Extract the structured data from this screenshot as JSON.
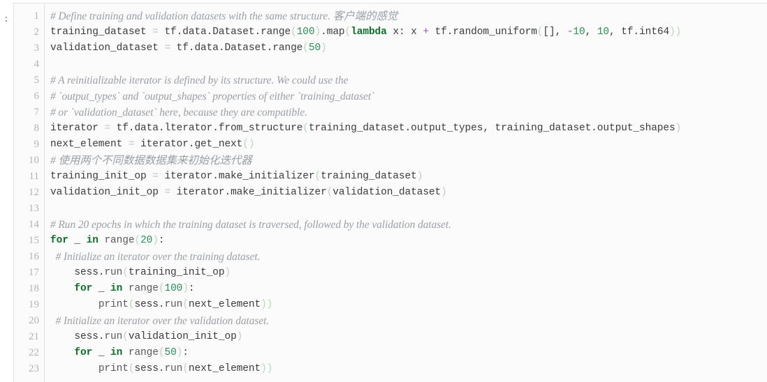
{
  "prompt": {
    "mark": ":"
  },
  "editor": {
    "language": "python",
    "first_line_number": 1,
    "total_lines_visible": 23,
    "background_color": "#fbfbfb",
    "gutter_color": "#fbfbfb",
    "line_number_color": "#b4b4b4",
    "text_color": "#3c3c3c",
    "comment_color": "#9aa0a6",
    "keyword_color": "#136c2e",
    "number_color": "#2e8b57",
    "operator_color": "#9b4dca"
  },
  "line_numbers": [
    "1",
    "2",
    "3",
    "4",
    "5",
    "6",
    "7",
    "8",
    "9",
    "10",
    "11",
    "12",
    "13",
    "14",
    "15",
    "16",
    "17",
    "18",
    "19",
    "20",
    "21",
    "22",
    "23"
  ],
  "lines": [
    {
      "number": "1",
      "text": "# Define training and validation datasets with the same structure. 客户端的感觉",
      "tokens": [
        {
          "t": "comment",
          "v": "# Define training and validation datasets with the same structure. "
        },
        {
          "t": "comment-cjk",
          "v": "客户端的感觉"
        }
      ]
    },
    {
      "number": "2",
      "text": "training_dataset = tf.data.Dataset.range(100).map(lambda x: x + tf.random_uniform([], -10, 10, tf.int64))",
      "tokens": [
        {
          "t": "text",
          "v": "training_dataset "
        },
        {
          "t": "assign",
          "v": "="
        },
        {
          "t": "text",
          "v": " tf."
        },
        {
          "t": "text",
          "v": "data."
        },
        {
          "t": "text",
          "v": "Dataset."
        },
        {
          "t": "text",
          "v": "range"
        },
        {
          "t": "paren",
          "v": "("
        },
        {
          "t": "number",
          "v": "100"
        },
        {
          "t": "paren",
          "v": ")"
        },
        {
          "t": "text",
          "v": ".map"
        },
        {
          "t": "paren",
          "v": "("
        },
        {
          "t": "keyword",
          "v": "lambda"
        },
        {
          "t": "text",
          "v": " x: x "
        },
        {
          "t": "operator",
          "v": "+"
        },
        {
          "t": "text",
          "v": " tf."
        },
        {
          "t": "text",
          "v": "random_uniform"
        },
        {
          "t": "paren",
          "v": "("
        },
        {
          "t": "text",
          "v": "[], "
        },
        {
          "t": "operator",
          "v": "-"
        },
        {
          "t": "number",
          "v": "10"
        },
        {
          "t": "text",
          "v": ", "
        },
        {
          "t": "number",
          "v": "10"
        },
        {
          "t": "text",
          "v": ", tf."
        },
        {
          "t": "text",
          "v": "int64"
        },
        {
          "t": "paren",
          "v": "))"
        }
      ]
    },
    {
      "number": "3",
      "text": "validation_dataset = tf.data.Dataset.range(50)",
      "tokens": [
        {
          "t": "text",
          "v": "validation_dataset "
        },
        {
          "t": "assign",
          "v": "="
        },
        {
          "t": "text",
          "v": " tf."
        },
        {
          "t": "text",
          "v": "data."
        },
        {
          "t": "text",
          "v": "Dataset."
        },
        {
          "t": "text",
          "v": "range"
        },
        {
          "t": "paren",
          "v": "("
        },
        {
          "t": "number",
          "v": "50"
        },
        {
          "t": "paren",
          "v": ")"
        }
      ]
    },
    {
      "number": "4",
      "text": "",
      "tokens": []
    },
    {
      "number": "5",
      "text": "# A reinitializable iterator is defined by its structure. We could use the",
      "tokens": [
        {
          "t": "comment",
          "v": "# A reinitializable iterator is defined by its structure. We could use the"
        }
      ]
    },
    {
      "number": "6",
      "text": "# `output_types` and `output_shapes` properties of either `training_dataset`",
      "tokens": [
        {
          "t": "comment",
          "v": "# `output_types` and `output_shapes` properties of either `training_dataset`"
        }
      ]
    },
    {
      "number": "7",
      "text": "# or `validation_dataset` here, because they are compatible.",
      "tokens": [
        {
          "t": "comment",
          "v": "# or `validation_dataset` here, because they are compatible."
        }
      ]
    },
    {
      "number": "8",
      "text": "iterator = tf.data.lterator.from_structure(training_dataset.output_types, training_dataset.output_shapes)",
      "tokens": [
        {
          "t": "text",
          "v": "iterator "
        },
        {
          "t": "assign",
          "v": "="
        },
        {
          "t": "text",
          "v": " tf."
        },
        {
          "t": "text",
          "v": "data."
        },
        {
          "t": "text",
          "v": "lterator."
        },
        {
          "t": "text",
          "v": "from_structure"
        },
        {
          "t": "paren",
          "v": "("
        },
        {
          "t": "text",
          "v": "training_dataset."
        },
        {
          "t": "text",
          "v": "output_types"
        },
        {
          "t": "text",
          "v": ", training_dataset."
        },
        {
          "t": "text",
          "v": "output_shapes"
        },
        {
          "t": "paren",
          "v": ")"
        }
      ]
    },
    {
      "number": "9",
      "text": "next_element = iterator.get_next()",
      "tokens": [
        {
          "t": "text",
          "v": "next_element "
        },
        {
          "t": "assign",
          "v": "="
        },
        {
          "t": "text",
          "v": " iterator."
        },
        {
          "t": "text",
          "v": "get_next"
        },
        {
          "t": "paren",
          "v": "()"
        }
      ]
    },
    {
      "number": "10",
      "text": "# 使用两个不同数据数据集来初始化迭代器",
      "tokens": [
        {
          "t": "comment",
          "v": "# "
        },
        {
          "t": "comment-cjk",
          "v": "使用两个不同数据数据集来初始化迭代器"
        }
      ]
    },
    {
      "number": "11",
      "text": "training_init_op = iterator.make_initializer(training_dataset)",
      "tokens": [
        {
          "t": "text",
          "v": "training_init_op "
        },
        {
          "t": "assign",
          "v": "="
        },
        {
          "t": "text",
          "v": " iterator."
        },
        {
          "t": "text",
          "v": "make_initializer"
        },
        {
          "t": "paren",
          "v": "("
        },
        {
          "t": "text",
          "v": "training_dataset"
        },
        {
          "t": "paren",
          "v": ")"
        }
      ]
    },
    {
      "number": "12",
      "text": "validation_init_op = iterator.make_initializer(validation_dataset)",
      "tokens": [
        {
          "t": "text",
          "v": "validation_init_op "
        },
        {
          "t": "assign",
          "v": "="
        },
        {
          "t": "text",
          "v": " iterator."
        },
        {
          "t": "text",
          "v": "make_initializer"
        },
        {
          "t": "paren",
          "v": "("
        },
        {
          "t": "text",
          "v": "validation_dataset"
        },
        {
          "t": "paren",
          "v": ")"
        }
      ]
    },
    {
      "number": "13",
      "text": "",
      "tokens": []
    },
    {
      "number": "14",
      "text": "# Run 20 epochs in which the training dataset is traversed, followed by the validation dataset.",
      "tokens": [
        {
          "t": "comment",
          "v": "# Run 20 epochs in which the training dataset is traversed, followed by the validation dataset."
        }
      ]
    },
    {
      "number": "15",
      "text": "for _ in range(20):",
      "tokens": [
        {
          "t": "keyword",
          "v": "for"
        },
        {
          "t": "text",
          "v": " _ "
        },
        {
          "t": "keyword",
          "v": "in"
        },
        {
          "t": "text",
          "v": " "
        },
        {
          "t": "func",
          "v": "range"
        },
        {
          "t": "paren",
          "v": "("
        },
        {
          "t": "number",
          "v": "20"
        },
        {
          "t": "paren",
          "v": ")"
        },
        {
          "t": "text",
          "v": ":"
        }
      ]
    },
    {
      "number": "16",
      "text": "  # Initialize an iterator over the training dataset.",
      "tokens": [
        {
          "t": "comment",
          "v": "  # Initialize an iterator over the training dataset."
        }
      ]
    },
    {
      "number": "17",
      "text": "    sess.run(training_init_op)",
      "tokens": [
        {
          "t": "text",
          "v": "    sess."
        },
        {
          "t": "func",
          "v": "run"
        },
        {
          "t": "paren",
          "v": "("
        },
        {
          "t": "text",
          "v": "training_init_op"
        },
        {
          "t": "paren",
          "v": ")"
        }
      ]
    },
    {
      "number": "18",
      "text": "    for _ in range(100):",
      "tokens": [
        {
          "t": "text",
          "v": "    "
        },
        {
          "t": "keyword",
          "v": "for"
        },
        {
          "t": "text",
          "v": " _ "
        },
        {
          "t": "keyword",
          "v": "in"
        },
        {
          "t": "text",
          "v": " "
        },
        {
          "t": "func",
          "v": "range"
        },
        {
          "t": "paren",
          "v": "("
        },
        {
          "t": "number",
          "v": "100"
        },
        {
          "t": "paren",
          "v": ")"
        },
        {
          "t": "text",
          "v": ":"
        }
      ]
    },
    {
      "number": "19",
      "text": "        print(sess.run(next_element))",
      "tokens": [
        {
          "t": "text",
          "v": "        "
        },
        {
          "t": "func",
          "v": "print"
        },
        {
          "t": "paren",
          "v": "("
        },
        {
          "t": "text",
          "v": "sess."
        },
        {
          "t": "func",
          "v": "run"
        },
        {
          "t": "paren",
          "v": "("
        },
        {
          "t": "text",
          "v": "next_element"
        },
        {
          "t": "paren",
          "v": "))"
        }
      ]
    },
    {
      "number": "20",
      "text": "  # Initialize an iterator over the validation dataset.",
      "tokens": [
        {
          "t": "comment",
          "v": "  # Initialize an iterator over the validation dataset."
        }
      ]
    },
    {
      "number": "21",
      "text": "    sess.run(validation_init_op)",
      "tokens": [
        {
          "t": "text",
          "v": "    sess."
        },
        {
          "t": "func",
          "v": "run"
        },
        {
          "t": "paren",
          "v": "("
        },
        {
          "t": "text",
          "v": "validation_init_op"
        },
        {
          "t": "paren",
          "v": ")"
        }
      ]
    },
    {
      "number": "22",
      "text": "    for _ in range(50):",
      "tokens": [
        {
          "t": "text",
          "v": "    "
        },
        {
          "t": "keyword",
          "v": "for"
        },
        {
          "t": "text",
          "v": " _ "
        },
        {
          "t": "keyword",
          "v": "in"
        },
        {
          "t": "text",
          "v": " "
        },
        {
          "t": "func",
          "v": "range"
        },
        {
          "t": "paren",
          "v": "("
        },
        {
          "t": "number",
          "v": "50"
        },
        {
          "t": "paren",
          "v": ")"
        },
        {
          "t": "text",
          "v": ":"
        }
      ]
    },
    {
      "number": "23",
      "text": "        print(sess.run(next_element))",
      "tokens": [
        {
          "t": "text",
          "v": "        "
        },
        {
          "t": "func",
          "v": "print"
        },
        {
          "t": "paren",
          "v": "("
        },
        {
          "t": "text",
          "v": "sess."
        },
        {
          "t": "func",
          "v": "run"
        },
        {
          "t": "paren",
          "v": "("
        },
        {
          "t": "text",
          "v": "next_element"
        },
        {
          "t": "paren",
          "v": "))"
        }
      ]
    }
  ]
}
